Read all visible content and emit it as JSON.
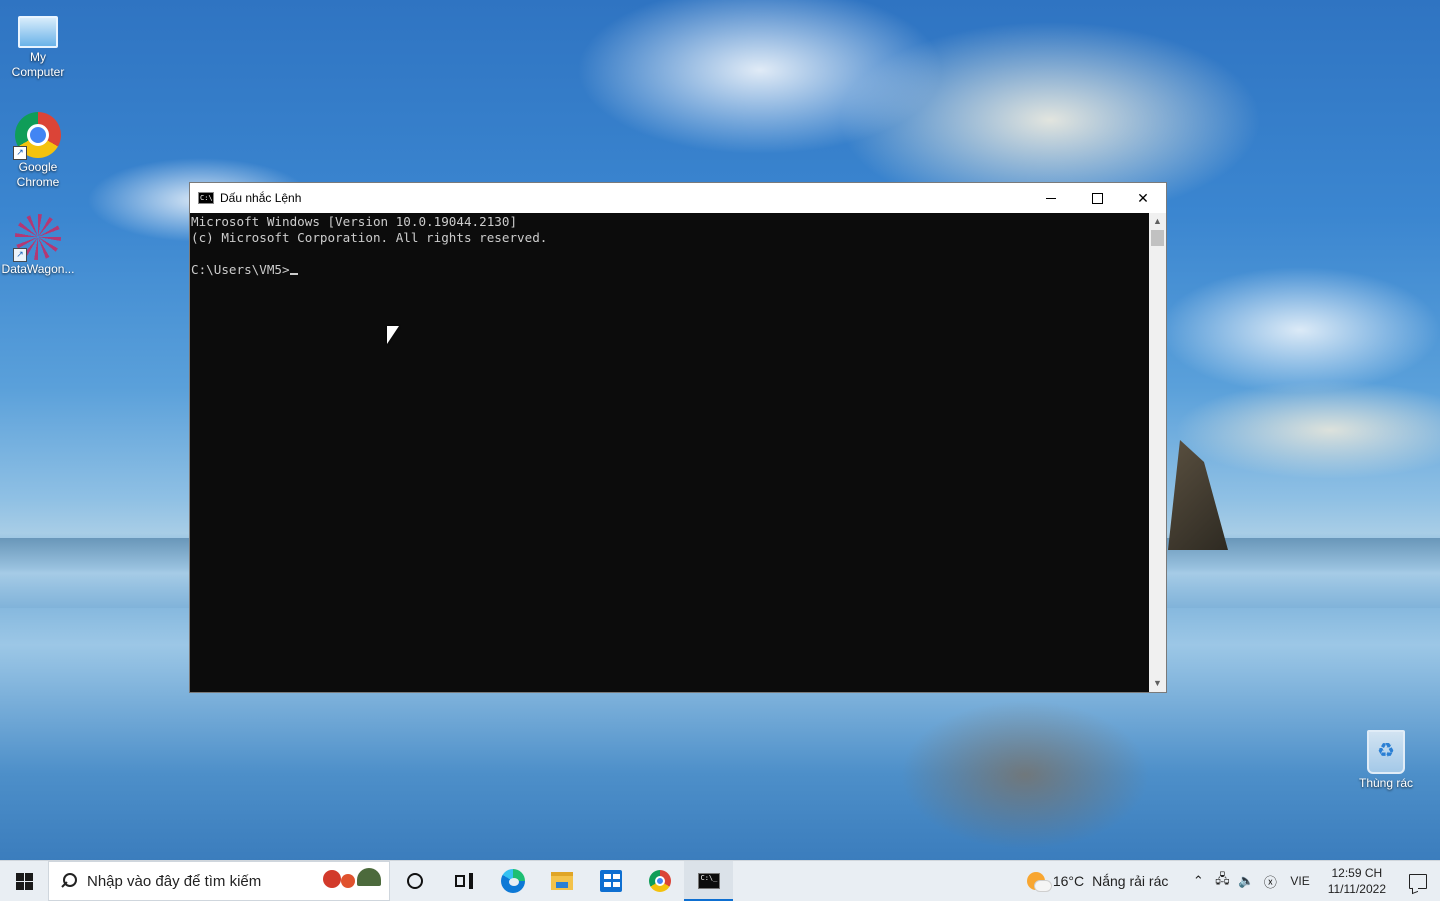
{
  "desktop": {
    "icons": [
      {
        "label_line1": "My",
        "label_line2": "Computer"
      },
      {
        "label_line1": "Google",
        "label_line2": "Chrome"
      },
      {
        "label_line1": "DataWagon...",
        "label_line2": ""
      }
    ],
    "recycle_bin_label": "Thùng rác"
  },
  "window": {
    "title": "Dấu nhắc Lệnh",
    "console_lines": [
      "Microsoft Windows [Version 10.0.19044.2130]",
      "(c) Microsoft Corporation. All rights reserved.",
      "",
      "C:\\Users\\VM5>"
    ]
  },
  "taskbar": {
    "search_placeholder": "Nhập vào đây để tìm kiếm",
    "weather_temp": "16°C",
    "weather_desc": "Nắng rải rác",
    "language": "VIE",
    "time": "12:59 CH",
    "date": "11/11/2022",
    "icons": [
      "start-icon",
      "search-icon",
      "cortana-icon",
      "task-view-icon",
      "edge-icon",
      "file-explorer-icon",
      "store-icon",
      "chrome-icon",
      "cmd-icon"
    ],
    "tray_icons": [
      "chevron-up-icon",
      "network-icon",
      "volume-icon",
      "close-circle-icon",
      "notification-icon"
    ]
  },
  "colors": {
    "console_bg": "#0c0c0c",
    "console_text": "#cccccc",
    "taskbar_bg": "#e9eef3",
    "accent": "#0e6fd1"
  }
}
